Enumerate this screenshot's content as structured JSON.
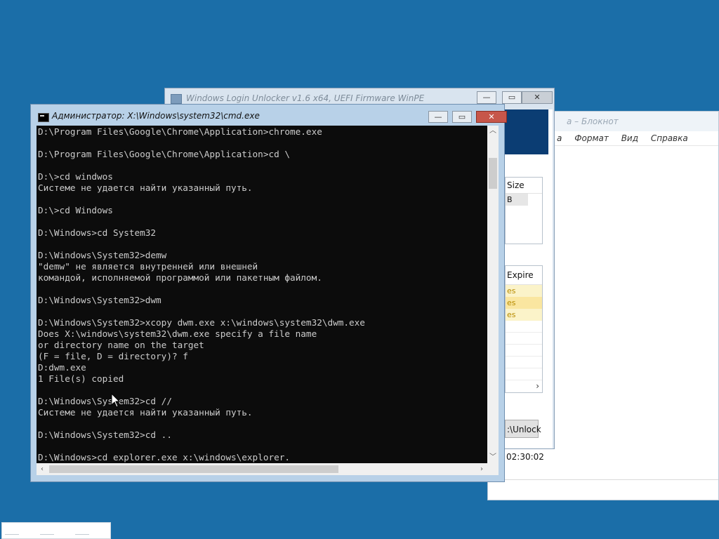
{
  "notepad": {
    "title": "а – Блокнот",
    "menu": [
      "а",
      "Формат",
      "Вид",
      "Справка"
    ]
  },
  "unlocker": {
    "title": "Windows Login Unlocker v1.6 x64, UEFI Firmware WinPE",
    "size_header": "Size",
    "size_cell": "B",
    "expire_header": "Expire",
    "expire_cells": [
      "es",
      "es",
      "es"
    ],
    "unlock_label": ":\\Unlock",
    "clock": "02:30:02",
    "hscroll_arrow": "›"
  },
  "cmd": {
    "title": "Администратор: X:\\Windows\\system32\\cmd.exe",
    "buttons": {
      "minimize": "—",
      "maximize": "▭",
      "close": "✕"
    },
    "lines": [
      "D:\\Program Files\\Google\\Chrome\\Application>chrome.exe",
      "",
      "D:\\Program Files\\Google\\Chrome\\Application>cd \\",
      "",
      "D:\\>cd windwos",
      "Системе не удается найти указанный путь.",
      "",
      "D:\\>cd Windows",
      "",
      "D:\\Windows>cd System32",
      "",
      "D:\\Windows\\System32>demw",
      "\"demw\" не является внутренней или внешней",
      "командой, исполняемой программой или пакетным файлом.",
      "",
      "D:\\Windows\\System32>dwm",
      "",
      "D:\\Windows\\System32>xcopy dwm.exe x:\\windows\\system32\\dwm.exe",
      "Does X:\\windows\\system32\\dwm.exe specify a file name",
      "or directory name on the target",
      "(F = file, D = directory)? f",
      "D:dwm.exe",
      "1 File(s) copied",
      "",
      "D:\\Windows\\System32>cd //",
      "Системе не удается найти указанный путь.",
      "",
      "D:\\Windows\\System32>cd ..",
      "",
      "D:\\Windows>cd explorer.exe x:\\windows\\explorer."
    ]
  },
  "colors": {
    "desktop": "#1b6ea8",
    "console_bg": "#0c0c0c",
    "console_fg": "#cccccc",
    "window_frame": "#b8d1e8",
    "close_button": "#c7564a"
  }
}
